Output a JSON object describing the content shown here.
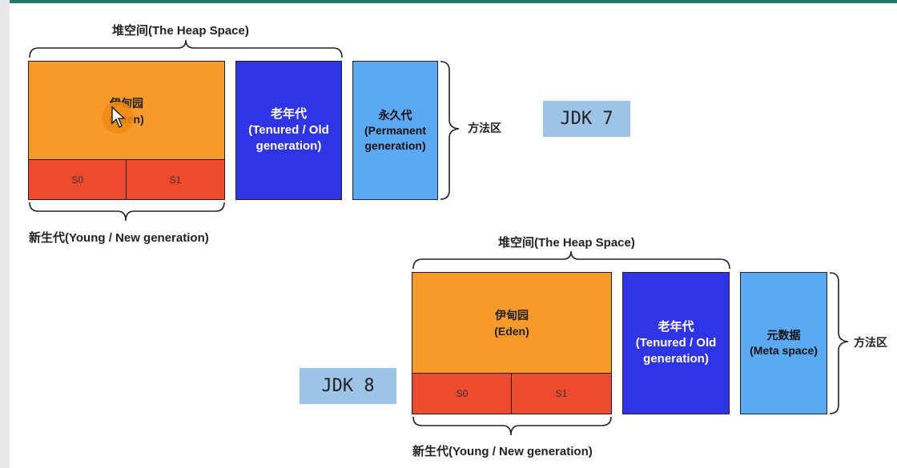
{
  "jdk7": {
    "heap_label": "堆空间(The Heap Space)",
    "eden_line1": "伊甸园",
    "eden_line2": "(Eden)",
    "s0": "S0",
    "s1": "S1",
    "old_line1": "老年代",
    "old_line2": "(Tenured / Old",
    "old_line3": "generation)",
    "perm_line1": "永久代",
    "perm_line2": "(Permanent",
    "perm_line3": "generation)",
    "method_area": "方法区",
    "young_label": "新生代(Young / New generation)",
    "jdk_label": "JDK 7"
  },
  "jdk8": {
    "heap_label": "堆空间(The Heap Space)",
    "eden_line1": "伊甸园",
    "eden_line2": "(Eden)",
    "s0": "S0",
    "s1": "S1",
    "old_line1": "老年代",
    "old_line2": "(Tenured / Old",
    "old_line3": "generation)",
    "meta_line1": "元数据",
    "meta_line2": "(Meta space)",
    "method_area": "方法区",
    "young_label": "新生代(Young / New generation)",
    "jdk_label": "JDK 8"
  },
  "colors": {
    "eden": "#f59a2b",
    "survivor": "#ee4a2e",
    "old_gen": "#2f35e6",
    "perm_meta": "#5aa9f2",
    "jdk_badge": "#9dc3e6"
  }
}
